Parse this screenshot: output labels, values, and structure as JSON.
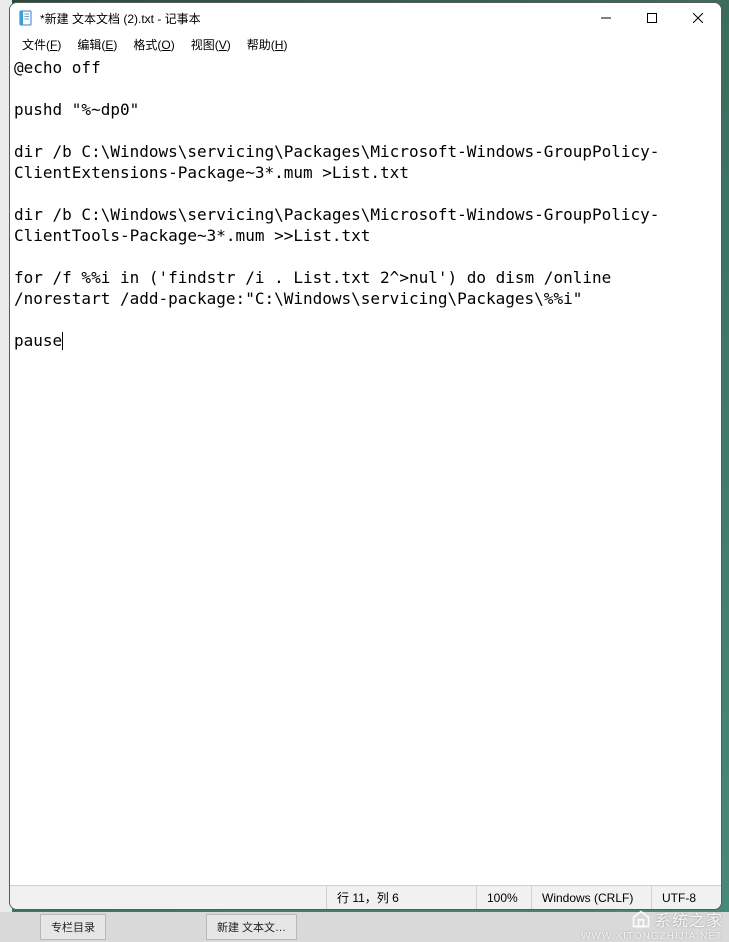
{
  "window": {
    "title": "*新建 文本文档 (2).txt - 记事本"
  },
  "menu": {
    "file": {
      "label": "文件",
      "accel": "F"
    },
    "edit": {
      "label": "编辑",
      "accel": "E"
    },
    "format": {
      "label": "格式",
      "accel": "O"
    },
    "view": {
      "label": "视图",
      "accel": "V"
    },
    "help": {
      "label": "帮助",
      "accel": "H"
    }
  },
  "content": {
    "text": "@echo off\n\npushd \"%~dp0\"\n\ndir /b C:\\Windows\\servicing\\Packages\\Microsoft-Windows-GroupPolicy-ClientExtensions-Package~3*.mum >List.txt\n\ndir /b C:\\Windows\\servicing\\Packages\\Microsoft-Windows-GroupPolicy-ClientTools-Package~3*.mum >>List.txt\n\nfor /f %%i in ('findstr /i . List.txt 2^>nul') do dism /online /norestart /add-package:\"C:\\Windows\\servicing\\Packages\\%%i\"\n\npause",
    "caret_line": 11,
    "caret_col": 6
  },
  "status": {
    "position": "行 11，列 6",
    "zoom": "100%",
    "line_ending": "Windows (CRLF)",
    "encoding": "UTF-8"
  },
  "taskbar": {
    "item1": "专栏目录",
    "item2": "新建 文本文…"
  },
  "watermark": {
    "brand": "系统之家",
    "url": "WWW.XITONGZHIJIA.NET"
  }
}
